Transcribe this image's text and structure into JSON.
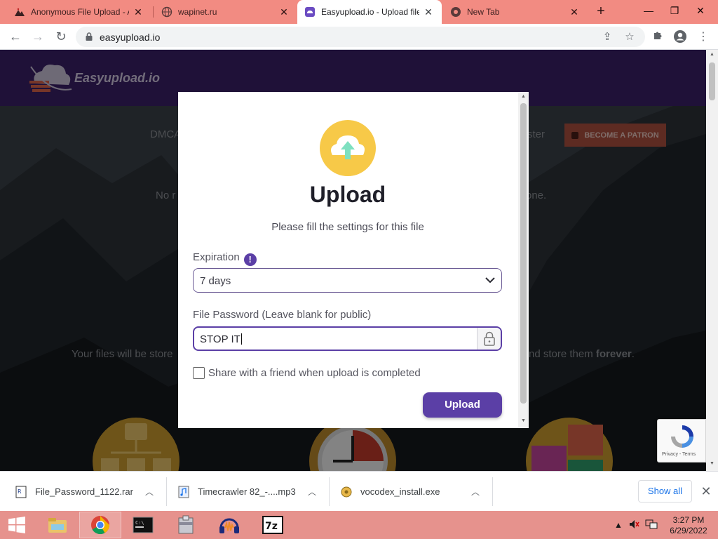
{
  "browser": {
    "tabs": [
      {
        "title": "Anonymous File Upload - A",
        "active": false
      },
      {
        "title": "wapinet.ru",
        "active": false
      },
      {
        "title": "Easyupload.io - Upload file",
        "active": true
      },
      {
        "title": "New Tab",
        "active": false
      }
    ],
    "new_tab_label": "+",
    "url": "easyupload.io"
  },
  "site": {
    "logo_text": "Easyupload.io",
    "nav_left": "DMCA",
    "nav_right": "ster",
    "patron_label": "BECOME A PATRON",
    "tagline_left": "No r",
    "tagline_right": "one.",
    "storage_text_left": "Your files will be store",
    "storage_text_right": "nd store them",
    "storage_text_bold": "forever",
    "storage_text_end": "."
  },
  "modal": {
    "title": "Upload",
    "subtitle": "Please fill the settings for this file",
    "expiration_label": "Expiration",
    "expiration_info": "!",
    "expiration_value": "7 days",
    "password_label": "File Password (Leave blank for public)",
    "password_value": "STOP IT",
    "share_label": "Share with a friend when upload is completed",
    "share_checked": false,
    "upload_button": "Upload"
  },
  "recaptcha": {
    "label": "Privacy - Terms"
  },
  "downloads": {
    "items": [
      {
        "name": "File_Password_1122.rar"
      },
      {
        "name": "Timecrawler 82_-....mp3"
      },
      {
        "name": "vocodex_install.exe"
      }
    ],
    "show_all": "Show all"
  },
  "taskbar": {
    "time": "3:27 PM",
    "date": "6/29/2022"
  },
  "colors": {
    "tab_strip": "#f28b82",
    "site_header": "#3a1f66",
    "accent_purple": "#5b3fa6",
    "taskbar": "#e6928d"
  }
}
